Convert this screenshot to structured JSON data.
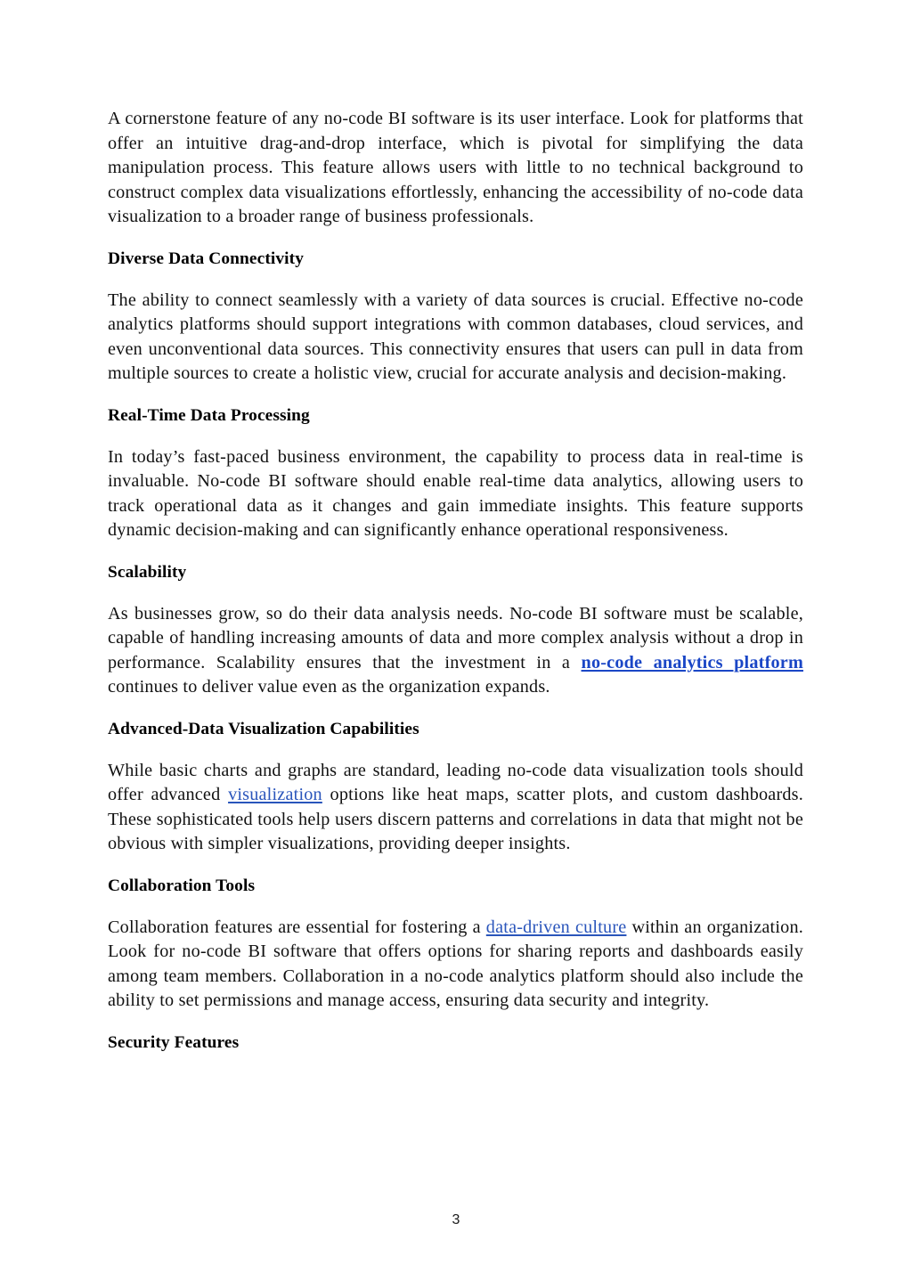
{
  "document": {
    "page_number": "3",
    "background_color": "#ffffff",
    "text_color": "#111111",
    "link_color": "#2a55bb",
    "strong_link_color": "#1a46c6"
  },
  "blocks": [
    {
      "type": "paragraph",
      "name": "intro-paragraph",
      "text": "A cornerstone feature of any no-code BI software is its user interface. Look for platforms that offer an intuitive drag-and-drop interface, which is pivotal for simplifying the data manipulation process. This feature allows users with little to no technical background to construct complex data visualizations effortlessly, enhancing the accessibility of no-code data visualization to a broader range of business professionals."
    },
    {
      "type": "heading",
      "name": "heading-diverse-data-connectivity",
      "text": "Diverse Data Connectivity"
    },
    {
      "type": "paragraph",
      "name": "paragraph-diverse-data-connectivity",
      "text": "The ability to connect seamlessly with a variety of data sources is crucial. Effective no-code analytics platforms should support integrations with common databases, cloud services, and even unconventional data sources. This connectivity ensures that users can pull in data from multiple sources to create a holistic view, crucial for accurate analysis and decision-making."
    },
    {
      "type": "heading",
      "name": "heading-real-time-data-processing",
      "text": "Real-Time Data Processing"
    },
    {
      "type": "paragraph",
      "name": "paragraph-real-time-data-processing",
      "text": "In today’s fast-paced business environment, the capability to process data in real-time is invaluable. No-code BI software should enable real-time data analytics, allowing users to track operational data as it changes and gain immediate insights. This feature supports dynamic decision-making and can significantly enhance operational responsiveness."
    },
    {
      "type": "heading",
      "name": "heading-scalability",
      "text": "Scalability"
    },
    {
      "type": "paragraph-with-link",
      "name": "paragraph-scalability",
      "text_before": "As businesses grow, so do their data analysis needs. No-code BI software must be scalable, capable of handling increasing amounts of data and more complex analysis without a drop in performance. Scalability ensures that the investment in a ",
      "link_text": "no-code analytics platform",
      "text_after": " continues to deliver value even as the organization expands."
    },
    {
      "type": "heading",
      "name": "heading-advanced-data-visualization-capabilities",
      "text": "Advanced-Data Visualization Capabilities"
    },
    {
      "type": "paragraph-with-link",
      "name": "paragraph-advanced-data-visualization",
      "text_before": "While basic charts and graphs are standard, leading no-code data visualization tools should offer advanced ",
      "link_text": "visualization",
      "text_after": " options like heat maps, scatter plots, and custom dashboards. These sophisticated tools help users discern patterns and correlations in data that might not be obvious with simpler visualizations, providing deeper insights."
    },
    {
      "type": "heading",
      "name": "heading-collaboration-tools",
      "text": "Collaboration Tools"
    },
    {
      "type": "paragraph-with-link",
      "name": "paragraph-collaboration-tools",
      "text_before": "Collaboration features are essential for fostering a ",
      "link_text": "data-driven culture",
      "text_after": " within an organization. Look for no-code BI software that offers options for sharing reports and dashboards easily among team members. Collaboration in a no-code analytics platform should also include the ability to set permissions and manage access, ensuring data security and integrity."
    },
    {
      "type": "heading",
      "name": "heading-security-features",
      "text": "Security Features"
    }
  ]
}
